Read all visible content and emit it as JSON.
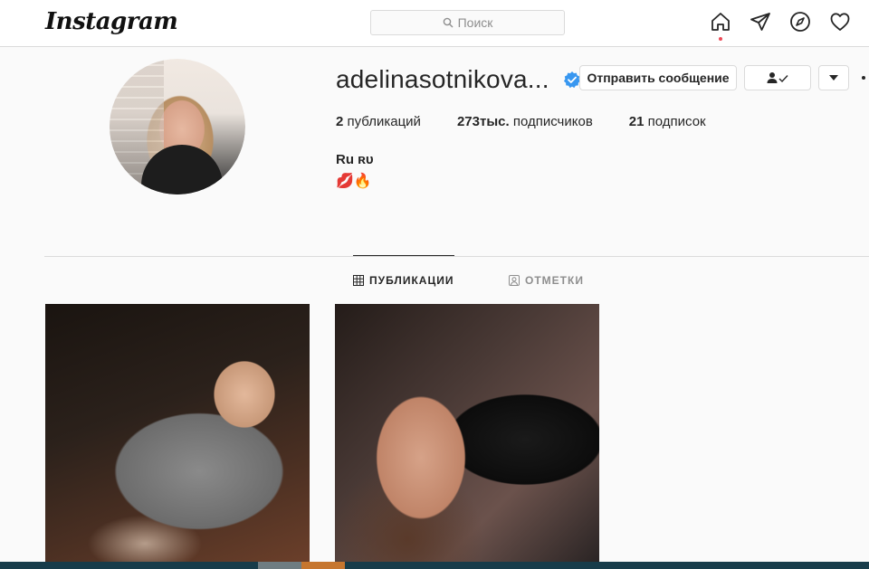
{
  "nav": {
    "logo": "Instagram",
    "search_placeholder": "Поиск",
    "icons": [
      "home-icon",
      "direct-icon",
      "explore-icon",
      "activity-icon"
    ]
  },
  "profile": {
    "username": "adelinasotnikova...",
    "verified": true,
    "message_button": "Отправить сообщение",
    "following_icon": "person-check-icon",
    "dropdown_icon": "caret-down-icon",
    "stats": {
      "posts_count": "2",
      "posts_label": "публикаций",
      "followers_count": "273тыс.",
      "followers_label": "подписчиков",
      "following_count": "21",
      "following_label": "подписок"
    },
    "full_name": "Ru ʀᴜ",
    "bio": "💋🔥"
  },
  "tabs": [
    {
      "label": "ПУБЛИКАЦИИ",
      "icon": "grid-icon",
      "active": true
    },
    {
      "label": "ОТМЕТКИ",
      "icon": "tagged-icon",
      "active": false
    }
  ],
  "colors": {
    "verified": "#3897f0",
    "notification_dot": "#ed4956",
    "border": "#dbdbdb"
  }
}
